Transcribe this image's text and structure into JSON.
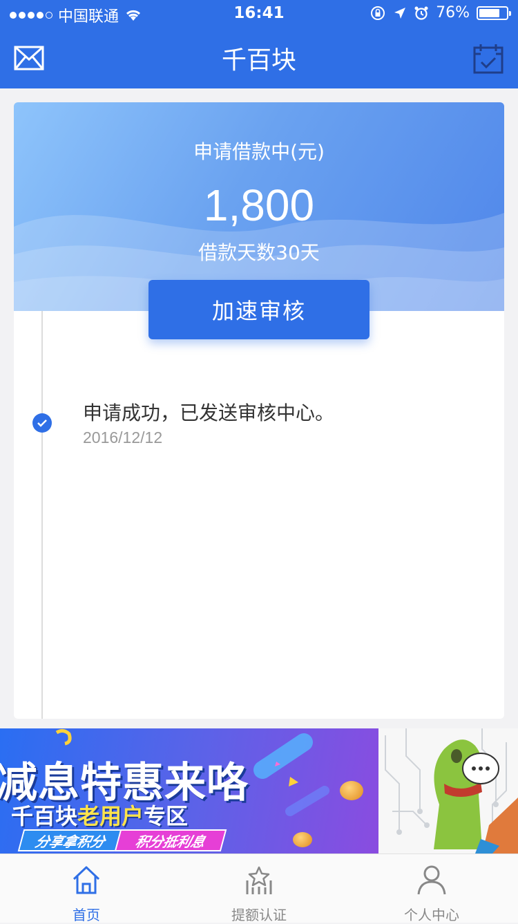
{
  "status_bar": {
    "carrier": "中国联通",
    "time": "16:41",
    "battery_percent": "76%",
    "battery_level": 0.76
  },
  "nav": {
    "title": "千百块",
    "left_icon": "mail-icon",
    "right_icon": "calendar-check-icon"
  },
  "loan": {
    "label": "申请借款中(元)",
    "amount": "1,800",
    "days": "借款天数30天",
    "speed_button": "加速审核"
  },
  "timeline": [
    {
      "text": "申请成功，已发送审核中心。",
      "date": "2016/12/12",
      "icon": "check-circle-icon"
    }
  ],
  "banner": {
    "title": "减息特惠来咯",
    "subtitle_prefix": "千百块",
    "subtitle_highlight": "老用户",
    "subtitle_suffix": "专区",
    "tag1": "分享拿积分",
    "tag2": "积分抵利息"
  },
  "tabs": [
    {
      "label": "首页",
      "icon": "home-icon",
      "active": true
    },
    {
      "label": "提额认证",
      "icon": "star-building-icon",
      "active": false
    },
    {
      "label": "个人中心",
      "icon": "person-icon",
      "active": false
    }
  ],
  "colors": {
    "primary": "#2f6fe6",
    "background": "#f2f2f4",
    "text_primary": "#333333",
    "text_secondary": "#999999"
  }
}
